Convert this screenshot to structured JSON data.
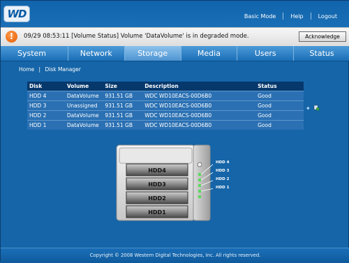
{
  "header": {
    "logo_text": "WD",
    "links": {
      "basic_mode": "Basic Mode",
      "help": "Help",
      "logout": "Logout"
    }
  },
  "alert": {
    "icon": "!",
    "message": "09/29 08:53:11 [Volume Status] Volume 'DataVolume' is in degraded mode.",
    "button": "Acknowledge"
  },
  "tabs": [
    {
      "label": "System",
      "active": false
    },
    {
      "label": "Network",
      "active": false
    },
    {
      "label": "Storage",
      "active": true
    },
    {
      "label": "Media",
      "active": false
    },
    {
      "label": "Users",
      "active": false
    },
    {
      "label": "Status",
      "active": false
    }
  ],
  "breadcrumb": {
    "home": "Home",
    "sep": "|",
    "current": "Disk Manager"
  },
  "disk_table": {
    "headers": {
      "disk": "Disk",
      "volume": "Volume",
      "size": "Size",
      "description": "Description",
      "status": "Status"
    },
    "rows": [
      {
        "disk": "HDD 4",
        "volume": "DataVolume",
        "size": "931.51 GB",
        "description": "WDC WD10EACS-00D6B0",
        "status": "Good"
      },
      {
        "disk": "HDD 3",
        "volume": "Unassigned",
        "size": "931.51 GB",
        "description": "WDC WD10EACS-00D6B0",
        "status": "Good"
      },
      {
        "disk": "HDD 2",
        "volume": "DataVolume",
        "size": "931.51 GB",
        "description": "WDC WD10EACS-00D6B0",
        "status": "Good"
      },
      {
        "disk": "HDD 1",
        "volume": "DataVolume",
        "size": "931.51 GB",
        "description": "WDC WD10EACS-00D6B0",
        "status": "Good"
      }
    ]
  },
  "device": {
    "bays": [
      "HDD4",
      "HDD3",
      "HDD2",
      "HDD1"
    ],
    "led_labels": [
      "HDD 4",
      "HDD 3",
      "HDD 2",
      "HDD 1"
    ]
  },
  "colors": {
    "background": "#1565a8",
    "table_header": "#06386c",
    "table_row": "#2a70b3",
    "alert_icon": "#e55a00"
  },
  "footer": {
    "text": "Copyright © 2008 Western Digital Technologies, Inc. All rights reserved."
  }
}
